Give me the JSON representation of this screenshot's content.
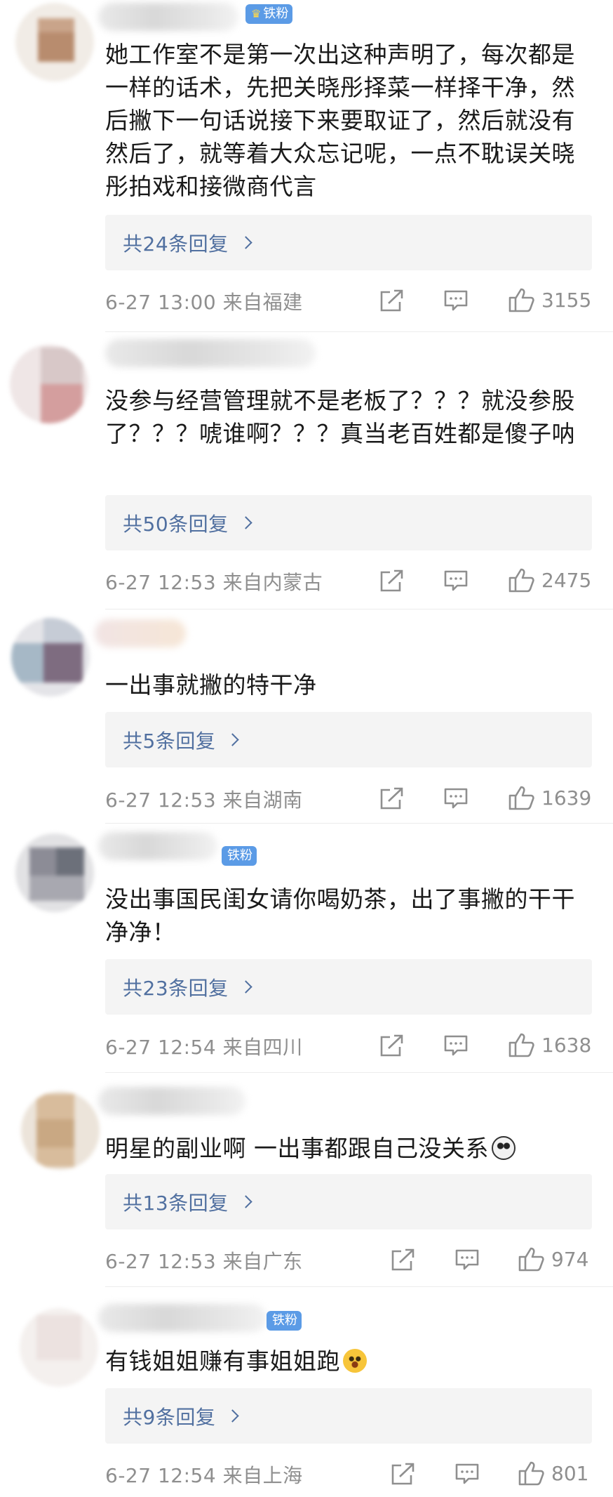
{
  "colors": {
    "link": "#5170a0",
    "meta": "#8f8f8f",
    "badge": "#5b9be6",
    "reply_bg": "#f4f4f4"
  },
  "comments": [
    {
      "badge": "铁粉",
      "text": "她工作室不是第一次出这种声明了，每次都是一样的话术，先把关晓彤择菜一样择干净，然后撇下一句话说接下来要取证了，然后就没有然后了，就等着大众忘记呢，一点不耽误关晓彤拍戏和接微商代言",
      "reply_label": "共24条回复",
      "date": "6-27",
      "time": "13:00",
      "location": "来自福建",
      "likes": "3155"
    },
    {
      "badge": "",
      "text": "没参与经营管理就不是老板了？？？就没参股了？？？唬谁啊？？？真当老百姓都是傻子呐",
      "reply_label": "共50条回复",
      "date": "6-27",
      "time": "12:53",
      "location": "来自内蒙古",
      "likes": "2475"
    },
    {
      "badge": "",
      "text": "一出事就撇的特干净",
      "reply_label": "共5条回复",
      "date": "6-27",
      "time": "12:53",
      "location": "来自湖南",
      "likes": "1639"
    },
    {
      "badge": "铁粉",
      "text": "没出事国民闺女请你喝奶茶，出了事撇的干干净净！",
      "reply_label": "共23条回复",
      "date": "6-27",
      "time": "12:54",
      "location": "来自四川",
      "likes": "1638"
    },
    {
      "badge": "",
      "text": "明星的副业啊 一出事都跟自己没关系",
      "emoji": "panda-face-emoji",
      "reply_label": "共13条回复",
      "date": "6-27",
      "time": "12:53",
      "location": "来自广东",
      "likes": "974"
    },
    {
      "badge": "铁粉",
      "text": "有钱姐姐赚有事姐姐跑",
      "emoji": "shocked-face-emoji",
      "reply_label": "共9条回复",
      "date": "6-27",
      "time": "12:54",
      "location": "来自上海",
      "likes": "801"
    }
  ]
}
